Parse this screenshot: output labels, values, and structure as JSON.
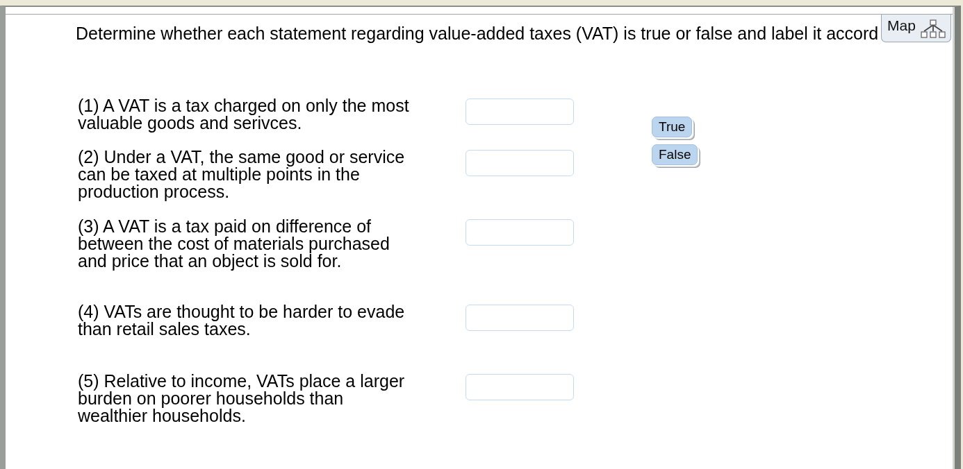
{
  "instruction": "Determine whether each statement regarding value-added taxes (VAT) is true or false and label it accord",
  "map_button": {
    "label": "Map"
  },
  "statements": [
    {
      "text": "(1) A VAT is a tax charged on only the most\nvaluable goods and serivces."
    },
    {
      "text": "(2) Under a VAT, the same good or service\ncan be taxed at multiple points in the\nproduction process."
    },
    {
      "text": "(3) A VAT is a tax paid on difference of\nbetween the cost of materials purchased\nand price that an object is sold for."
    },
    {
      "text": "(4) VATs are thought to be harder to evade\nthan retail sales taxes."
    },
    {
      "text": "(5) Relative to income, VATs place a larger\nburden on poorer households than\nwealthier households."
    }
  ],
  "choices": [
    {
      "label": "True"
    },
    {
      "label": "False"
    }
  ]
}
